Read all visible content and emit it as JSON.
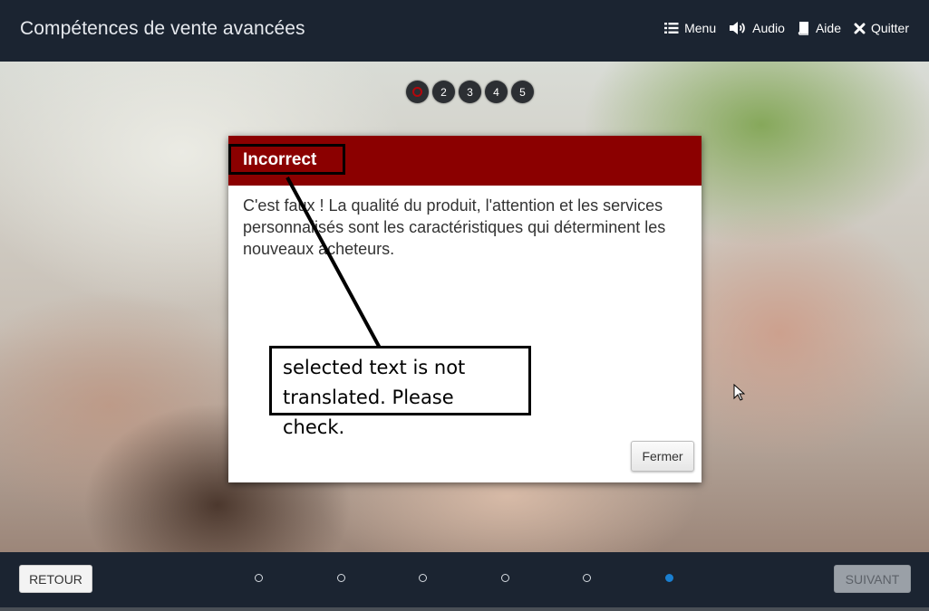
{
  "app": {
    "title": "Compétences de vente avancées"
  },
  "topnav": [
    {
      "label": "Menu",
      "icon": "menu-list-icon"
    },
    {
      "label": "Audio",
      "icon": "speaker-icon"
    },
    {
      "label": "Aide",
      "icon": "help-book-icon"
    },
    {
      "label": "Quitter",
      "icon": "close-x-icon"
    }
  ],
  "progress": {
    "steps": [
      "",
      "2",
      "3",
      "4",
      "5"
    ],
    "current_marker_color": "#b3070c"
  },
  "modal": {
    "title": "Incorrect",
    "body": "C'est faux ! La qualité du produit, l'attention et les services personnalisés sont les caractéristiques qui déterminent les nouveaux acheteurs.",
    "close_label": "Fermer",
    "header_color": "#8b0000"
  },
  "annotation": {
    "lines": [
      "selected text is not",
      "translated. Please check."
    ]
  },
  "footer": {
    "back_label": "RETOUR",
    "next_label": "SUIVANT",
    "page_count": 6,
    "active_page": 6,
    "active_color": "#1a7fd0"
  }
}
